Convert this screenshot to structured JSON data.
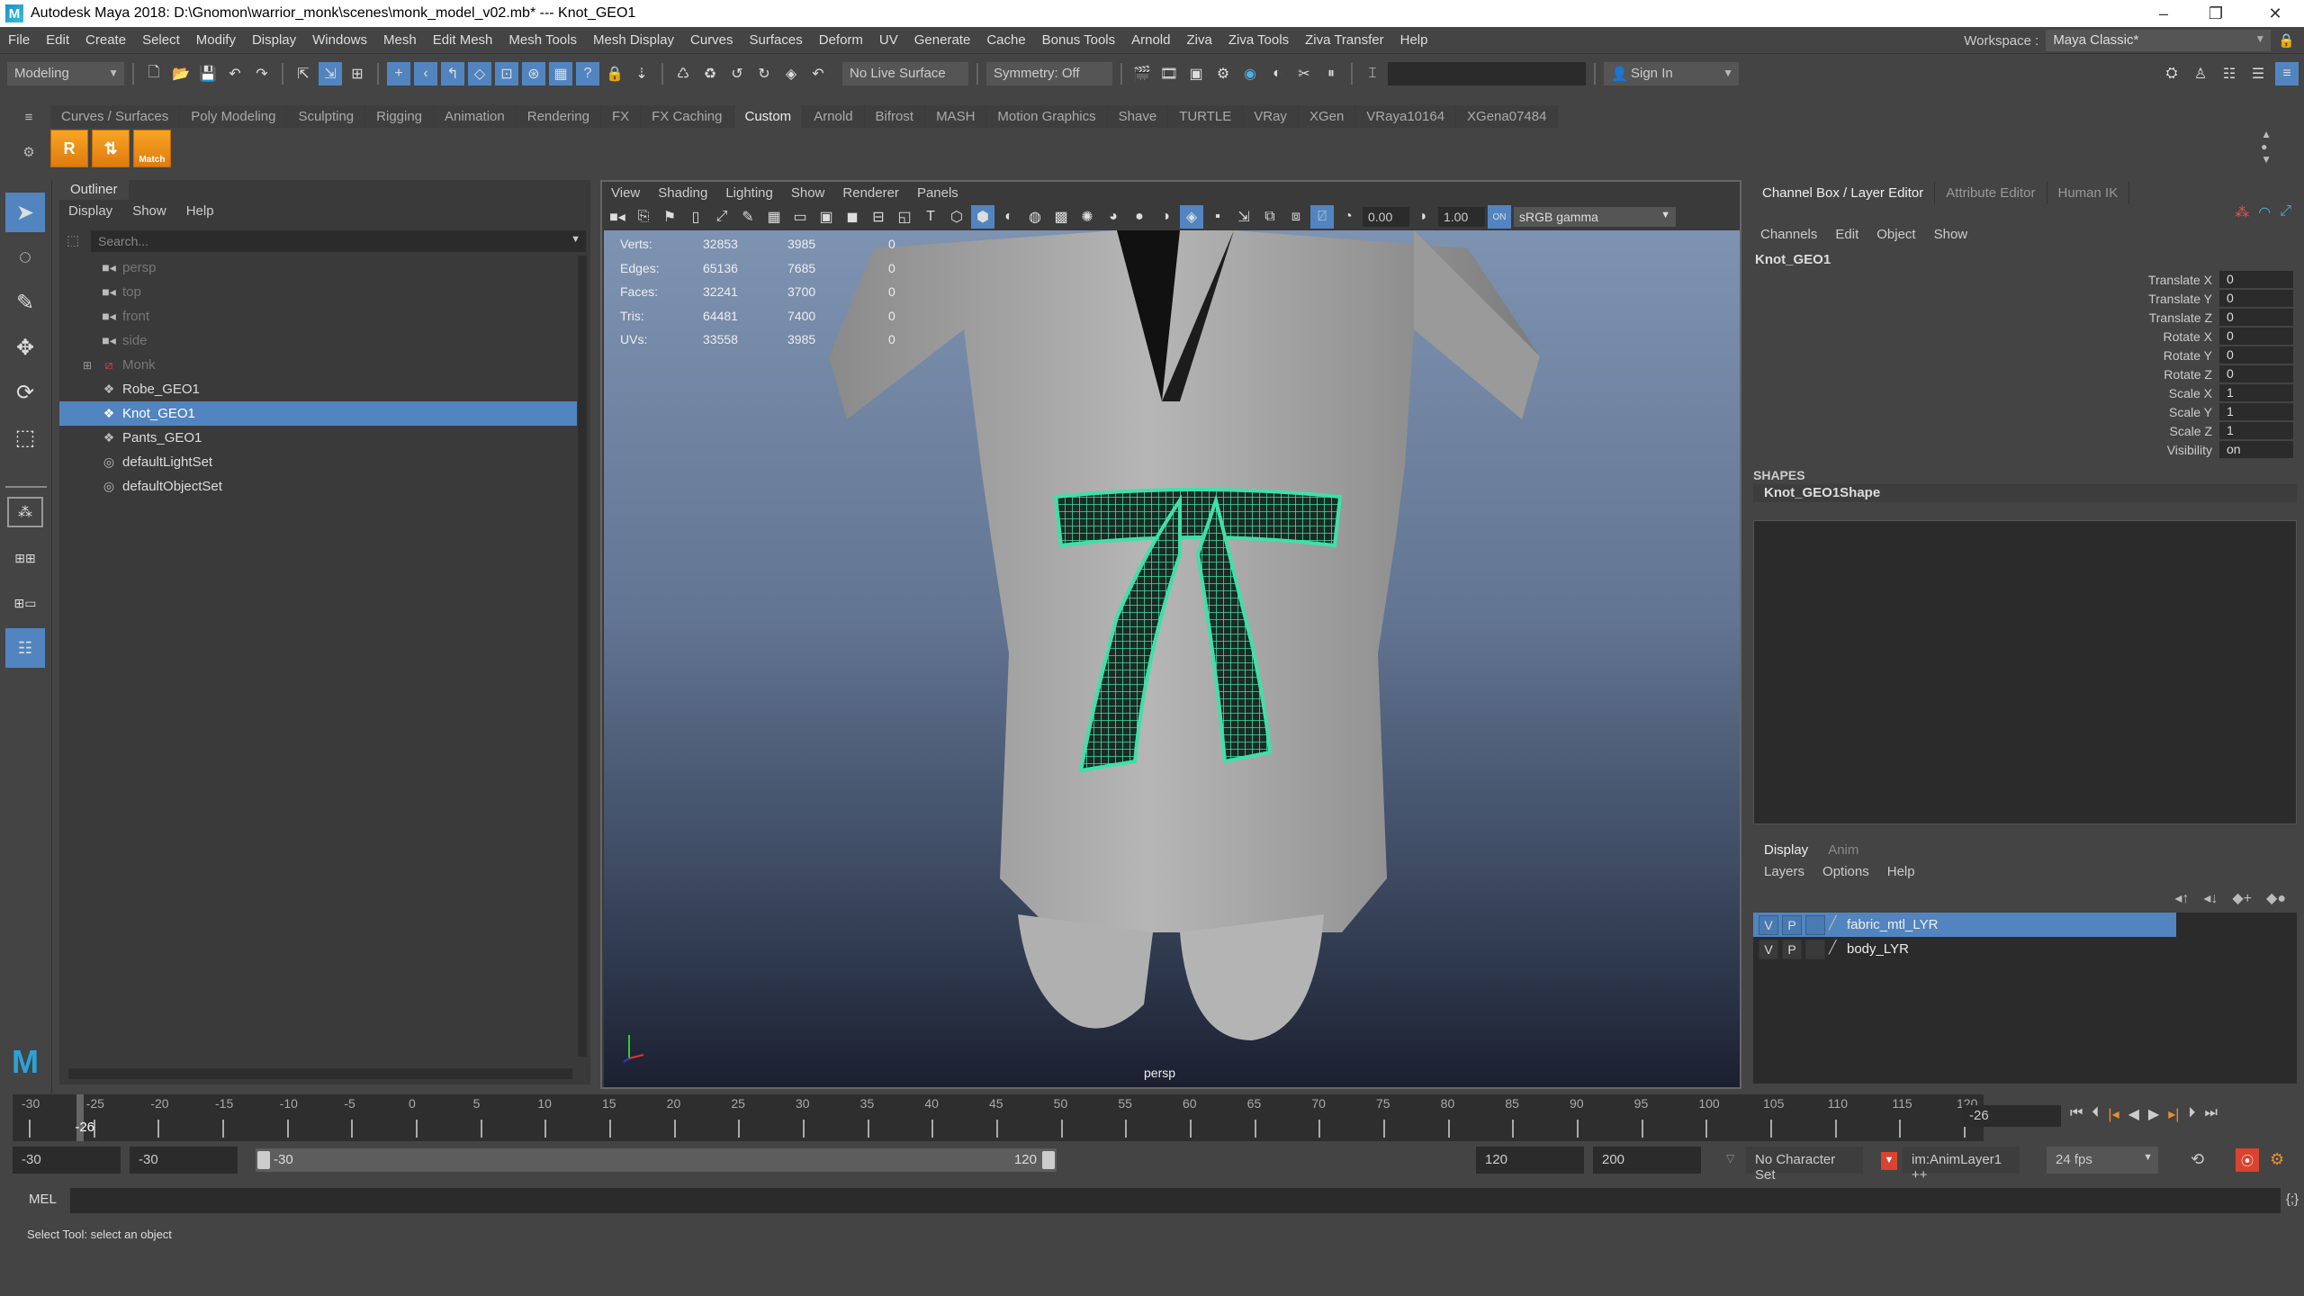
{
  "window": {
    "title": "Autodesk Maya 2018: D:\\Gnomon\\warrior_monk\\scenes\\monk_model_v02.mb*  ---  Knot_GEO1",
    "controls": {
      "minimize": "–",
      "restore": "❐",
      "close": "✕"
    }
  },
  "menubar": {
    "items": [
      "File",
      "Edit",
      "Create",
      "Select",
      "Modify",
      "Display",
      "Windows",
      "Mesh",
      "Edit Mesh",
      "Mesh Tools",
      "Mesh Display",
      "Curves",
      "Surfaces",
      "Deform",
      "UV",
      "Generate",
      "Cache",
      "Bonus Tools",
      "Arnold",
      "Ziva",
      "Ziva Tools",
      "Ziva Transfer",
      "Help"
    ],
    "workspace_label": "Workspace :",
    "workspace_value": "Maya Classic*"
  },
  "statusline": {
    "menuset": "Modeling",
    "live_surface": "No Live Surface",
    "symmetry": "Symmetry: Off",
    "sign_in": "Sign In"
  },
  "shelf": {
    "tabs": [
      "Curves / Surfaces",
      "Poly Modeling",
      "Sculpting",
      "Rigging",
      "Animation",
      "Rendering",
      "FX",
      "FX Caching",
      "Custom",
      "Arnold",
      "Bifrost",
      "MASH",
      "Motion Graphics",
      "Shave",
      "TURTLE",
      "VRay",
      "XGen",
      "VRaya10164",
      "XGena07484"
    ],
    "active_tab": "Custom",
    "buttons": [
      {
        "label": "R"
      },
      {
        "label": "⇅"
      },
      {
        "label": "Match"
      }
    ]
  },
  "outliner": {
    "title": "Outliner",
    "menu": [
      "Display",
      "Show",
      "Help"
    ],
    "search_placeholder": "Search...",
    "items": [
      {
        "label": "persp",
        "icon": "camera-icon",
        "dim": true
      },
      {
        "label": "top",
        "icon": "camera-icon",
        "dim": true
      },
      {
        "label": "front",
        "icon": "camera-icon",
        "dim": true
      },
      {
        "label": "side",
        "icon": "camera-icon",
        "dim": true
      },
      {
        "label": "Monk",
        "icon": "group-icon",
        "dim": true,
        "expandable": true
      },
      {
        "label": "Robe_GEO1",
        "icon": "mesh-icon"
      },
      {
        "label": "Knot_GEO1",
        "icon": "mesh-icon",
        "selected": true
      },
      {
        "label": "Pants_GEO1",
        "icon": "mesh-icon"
      },
      {
        "label": "defaultLightSet",
        "icon": "set-icon"
      },
      {
        "label": "defaultObjectSet",
        "icon": "set-icon"
      }
    ]
  },
  "viewport": {
    "menu": [
      "View",
      "Shading",
      "Lighting",
      "Show",
      "Renderer",
      "Panels"
    ],
    "exposure": "0.00",
    "gamma": "1.00",
    "color_space": "sRGB gamma",
    "camera_name": "persp",
    "hud": [
      {
        "label": "Verts:",
        "total": "32853",
        "selected": "3985",
        "components": "0"
      },
      {
        "label": "Edges:",
        "total": "65136",
        "selected": "7685",
        "components": "0"
      },
      {
        "label": "Faces:",
        "total": "32241",
        "selected": "3700",
        "components": "0"
      },
      {
        "label": "Tris:",
        "total": "64481",
        "selected": "7400",
        "components": "0"
      },
      {
        "label": "UVs:",
        "total": "33558",
        "selected": "3985",
        "components": "0"
      }
    ],
    "highlight_color": "#3fe0a8"
  },
  "channelbox": {
    "tabs": [
      "Channel Box / Layer Editor",
      "Attribute Editor",
      "Human IK"
    ],
    "menu": [
      "Channels",
      "Edit",
      "Object",
      "Show"
    ],
    "object": "Knot_GEO1",
    "attributes": [
      {
        "name": "Translate X",
        "value": "0"
      },
      {
        "name": "Translate Y",
        "value": "0"
      },
      {
        "name": "Translate Z",
        "value": "0"
      },
      {
        "name": "Rotate X",
        "value": "0"
      },
      {
        "name": "Rotate Y",
        "value": "0"
      },
      {
        "name": "Rotate Z",
        "value": "0"
      },
      {
        "name": "Scale X",
        "value": "1"
      },
      {
        "name": "Scale Y",
        "value": "1"
      },
      {
        "name": "Scale Z",
        "value": "1"
      },
      {
        "name": "Visibility",
        "value": "on"
      }
    ],
    "shapes_header": "SHAPES",
    "shape_name": "Knot_GEO1Shape"
  },
  "layereditor": {
    "tabs": [
      "Display",
      "Anim"
    ],
    "menu": [
      "Layers",
      "Options",
      "Help"
    ],
    "layers": [
      {
        "v": "V",
        "p": "P",
        "name": "fabric_mtl_LYR",
        "selected": true
      },
      {
        "v": "V",
        "p": "P",
        "name": "body_LYR"
      }
    ]
  },
  "timeline": {
    "ticks": [
      "-30",
      "-25",
      "-20",
      "-15",
      "-10",
      "-5",
      "0",
      "5",
      "10",
      "15",
      "20",
      "25",
      "30",
      "35",
      "40",
      "45",
      "50",
      "55",
      "60",
      "65",
      "70",
      "75",
      "80",
      "85",
      "90",
      "95",
      "100",
      "105",
      "110",
      "115",
      "120"
    ],
    "range_min": -30,
    "range_max": 120,
    "current_frame": "-26",
    "current_frame_value": -26,
    "playback_buttons": [
      "⏮",
      "⏴|",
      "|◀",
      "◀",
      "▶",
      "▶|",
      "|⏵",
      "⏭"
    ]
  },
  "rangeslider": {
    "anim_start": "-30",
    "playback_start": "-30",
    "slider_start": "-30",
    "slider_end": "120",
    "playback_end": "120",
    "anim_end": "200",
    "character_set": "No Character Set",
    "anim_layer": "im:AnimLayer1 ++",
    "fps": "24 fps"
  },
  "commandline": {
    "language": "MEL",
    "help_text": "Select Tool: select an object"
  }
}
